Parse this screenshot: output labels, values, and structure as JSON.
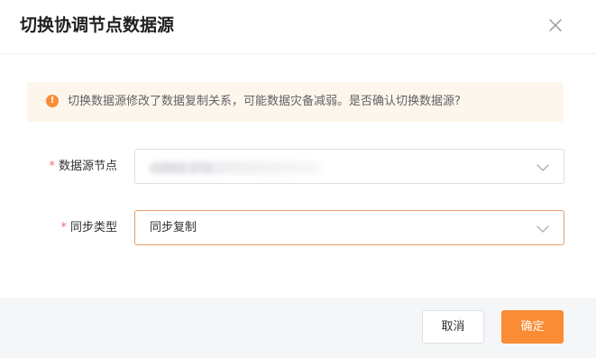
{
  "dialog": {
    "title": "切换协调节点数据源",
    "close_icon": "close-icon"
  },
  "warning": {
    "icon": "exclamation-icon",
    "text": "切换数据源修改了数据复制关系，可能数据灾备减弱。是否确认切换数据源?"
  },
  "form": {
    "source": {
      "required_mark": "*",
      "label": "数据源节点",
      "value": "cn001-172.",
      "chevron_icon": "chevron-down-icon"
    },
    "sync_type": {
      "required_mark": "*",
      "label": "同步类型",
      "value": "同步复制",
      "chevron_icon": "chevron-down-icon"
    }
  },
  "footer": {
    "cancel_label": "取消",
    "ok_label": "确定"
  },
  "colors": {
    "accent": "#fa8c35",
    "warning_bg": "#fdf6ec",
    "required": "#f56c6c"
  }
}
